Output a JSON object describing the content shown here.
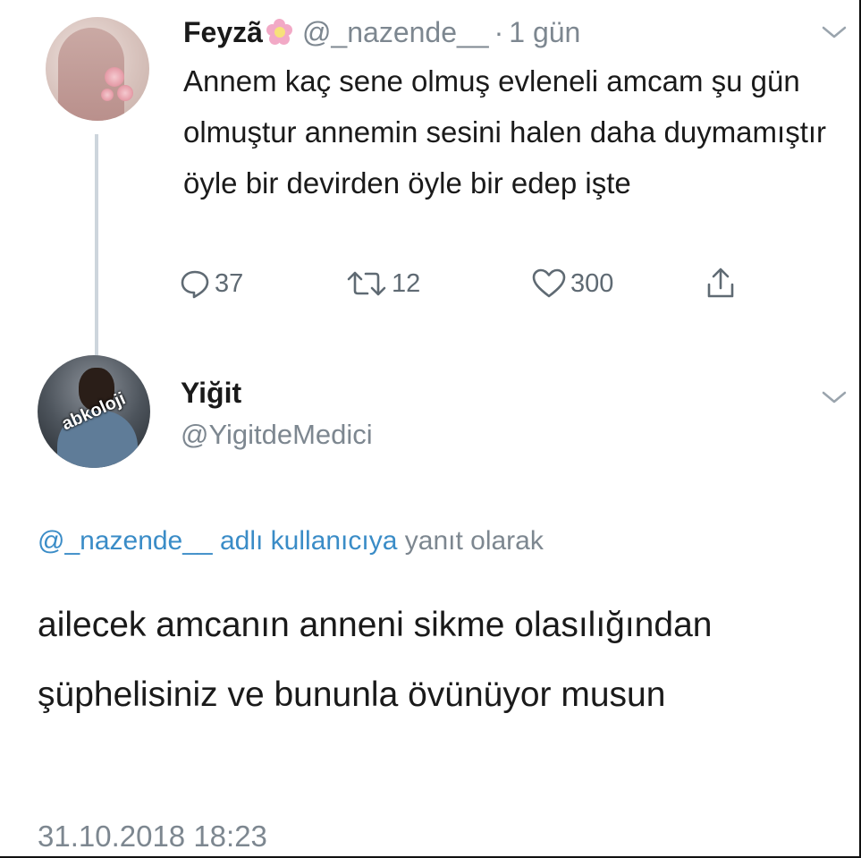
{
  "tweet1": {
    "name": "Feyzã",
    "name_emoji": "flower-icon",
    "handle": "@_nazende__",
    "separator": "·",
    "time": "1 gün",
    "text": "Annem kaç sene olmuş evleneli amcam şu gün olmuştur annemin sesini halen daha duymamıştır öyle bir devirden öyle bir edep işte",
    "replies": "37",
    "retweets": "12",
    "likes": "300"
  },
  "tweet2": {
    "name": "Yiğit",
    "handle": "@YigitdeMedici",
    "avatar_watermark": "abkoloji",
    "reply_handle": "@_nazende__",
    "reply_middle": "adlı kullanıcıya",
    "reply_suffix": "yanıt olarak",
    "text": "ailecek amcanın anneni sikme olasılığından şüphelisiniz ve bununla övünüyor musun",
    "timestamp": "31.10.2018 18:23"
  },
  "colors": {
    "text": "#1a1a1a",
    "muted": "#7d8790",
    "link": "#3a8cc7",
    "thread_line": "#cdd5dc"
  }
}
